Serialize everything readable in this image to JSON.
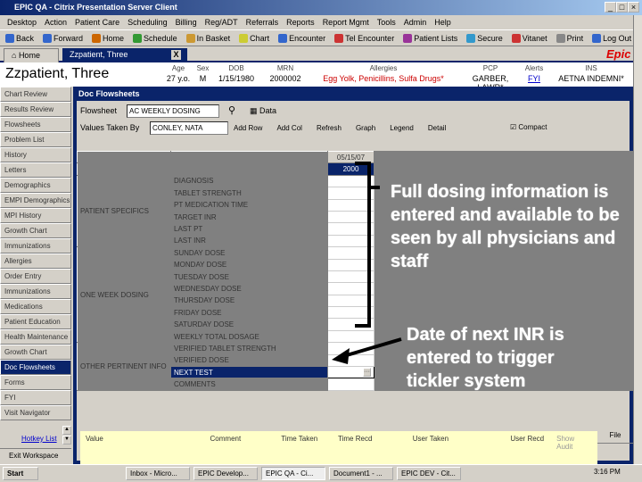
{
  "window": {
    "title": "EPIC QA - Citrix Presentation Server Client"
  },
  "menu": [
    "Desktop",
    "Action",
    "Patient Care",
    "Scheduling",
    "Billing",
    "Reg/ADT",
    "Referrals",
    "Reports",
    "Report Mgmt",
    "Tools",
    "Admin",
    "Help"
  ],
  "toolbar": [
    "Back",
    "Forward",
    "Home",
    "Schedule",
    "In Basket",
    "Chart",
    "Encounter",
    "Tel Encounter",
    "Patient Lists",
    "Secure",
    "Vitanet",
    "Print",
    "Log Out"
  ],
  "tabs": {
    "home": "Home",
    "patient": "Zzpatient, Three",
    "close": "X"
  },
  "brand": "Epic",
  "patient": {
    "name": "Zzpatient, Three",
    "fields": [
      {
        "label": "Age",
        "value": "27 y.o."
      },
      {
        "label": "Sex",
        "value": "M"
      },
      {
        "label": "DOB",
        "value": "1/15/1980"
      },
      {
        "label": "MRN",
        "value": "2000002"
      },
      {
        "label": "Allergies",
        "value": "Egg Yolk, Penicillins, Sulfa Drugs*"
      },
      {
        "label": "PCP",
        "value": "GARBER, LAWR*"
      },
      {
        "label": "Alerts",
        "value": "FYI"
      },
      {
        "label": "INS",
        "value": "AETNA INDEMNI*"
      }
    ]
  },
  "sidebar": {
    "items": [
      "Chart Review",
      "Results Review",
      "Flowsheets",
      "Problem List",
      "History",
      "Letters",
      "Demographics",
      "EMPI Demographics",
      "MPI History",
      "Growth Chart",
      "Immunizations",
      "Allergies",
      "Order Entry",
      "Immunizations",
      "Medications",
      "Patient Education",
      "Health Maintenance",
      "Growth Chart",
      "Doc Flowsheets",
      "Forms",
      "FYI",
      "Visit Navigator"
    ],
    "selected": "Doc Flowsheets",
    "hotkey": "Hotkey List",
    "exit": "Exit Workspace"
  },
  "flowsheet": {
    "title": "Doc Flowsheets",
    "flowsheet_label": "Flowsheet",
    "flowsheet_value": "AC WEEKLY DOSING",
    "data_label": "Data",
    "taken_label": "Values Taken By",
    "taken_value": "CONLEY, NATA",
    "buttons": [
      "Add Row",
      "Add Col",
      "Refresh",
      "Graph",
      "Legend",
      "Detail"
    ],
    "compact": "Compact",
    "compact_checked": true,
    "date": "05/15/07",
    "time": "2000",
    "groups": [
      {
        "name": "PATIENT SPECIFICS",
        "rows": [
          "DIAGNOSIS",
          "TABLET STRENGTH",
          "PT MEDICATION TIME",
          "TARGET INR",
          "LAST PT",
          "LAST INR"
        ]
      },
      {
        "name": "ONE WEEK DOSING",
        "rows": [
          "SUNDAY DOSE",
          "MONDAY DOSE",
          "TUESDAY DOSE",
          "WEDNESDAY DOSE",
          "THURSDAY DOSE",
          "FRIDAY DOSE",
          "SATURDAY DOSE",
          "WEEKLY TOTAL DOSAGE"
        ]
      },
      {
        "name": "OTHER PERTINENT INFO",
        "rows": [
          "VERIFIED TABLET STRENGTH",
          "VERIFIED DOSE",
          "NEXT TEST",
          "COMMENTS"
        ]
      }
    ],
    "selected_row": "NEXT TEST"
  },
  "detail": {
    "columns": [
      "Value",
      "Comment",
      "Time Taken",
      "Time Recd",
      "User Taken",
      "User Recd",
      "Show Audit"
    ],
    "file": "File"
  },
  "annotations": {
    "top": "Full dosing information is entered and available to be seen by all physicians and staff",
    "bottom": "Date of next INR is entered to trigger tickler system"
  },
  "taskbar": {
    "start": "Start",
    "tasks": [
      "Inbox - Micro...",
      "EPIC Develop...",
      "EPIC QA - Ci...",
      "Document1 - ...",
      "EPIC DEV - Cit..."
    ],
    "clock": "3:16 PM"
  }
}
